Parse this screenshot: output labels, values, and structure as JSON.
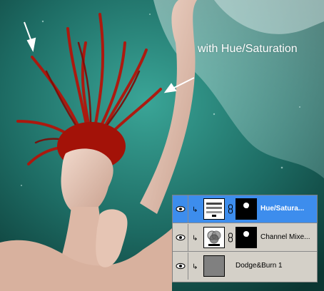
{
  "annotation": {
    "text": "with Hue/Saturation"
  },
  "layers_panel": {
    "layers": [
      {
        "name": "Hue/Satura...",
        "type": "hue-saturation-adjustment",
        "selected": true,
        "visible": true,
        "clipped": true,
        "has_mask": true
      },
      {
        "name": "Channel Mixe...",
        "type": "channel-mixer-adjustment",
        "selected": false,
        "visible": true,
        "clipped": true,
        "has_mask": true
      },
      {
        "name": "Dodge&Burn 1",
        "type": "pixel-layer",
        "selected": false,
        "visible": true,
        "clipped": true,
        "has_mask": false
      }
    ]
  },
  "colors": {
    "selection": "#3d8ded",
    "panel_bg": "#d4d0c8",
    "hair": "#b3140a",
    "background": "#1d6b63"
  }
}
